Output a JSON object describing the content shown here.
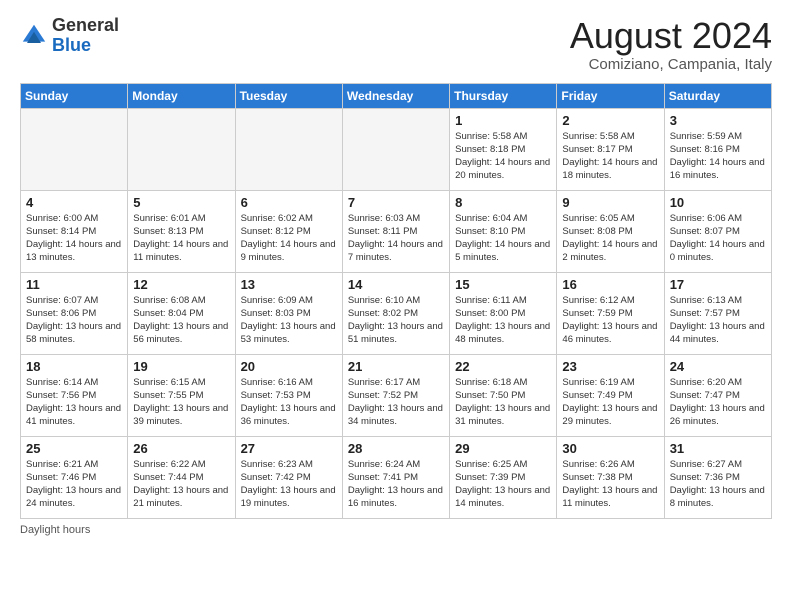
{
  "logo": {
    "general": "General",
    "blue": "Blue"
  },
  "title": {
    "month_year": "August 2024",
    "location": "Comiziano, Campania, Italy"
  },
  "days_of_week": [
    "Sunday",
    "Monday",
    "Tuesday",
    "Wednesday",
    "Thursday",
    "Friday",
    "Saturday"
  ],
  "weeks": [
    [
      {
        "day": "",
        "info": ""
      },
      {
        "day": "",
        "info": ""
      },
      {
        "day": "",
        "info": ""
      },
      {
        "day": "",
        "info": ""
      },
      {
        "day": "1",
        "info": "Sunrise: 5:58 AM\nSunset: 8:18 PM\nDaylight: 14 hours and 20 minutes."
      },
      {
        "day": "2",
        "info": "Sunrise: 5:58 AM\nSunset: 8:17 PM\nDaylight: 14 hours and 18 minutes."
      },
      {
        "day": "3",
        "info": "Sunrise: 5:59 AM\nSunset: 8:16 PM\nDaylight: 14 hours and 16 minutes."
      }
    ],
    [
      {
        "day": "4",
        "info": "Sunrise: 6:00 AM\nSunset: 8:14 PM\nDaylight: 14 hours and 13 minutes."
      },
      {
        "day": "5",
        "info": "Sunrise: 6:01 AM\nSunset: 8:13 PM\nDaylight: 14 hours and 11 minutes."
      },
      {
        "day": "6",
        "info": "Sunrise: 6:02 AM\nSunset: 8:12 PM\nDaylight: 14 hours and 9 minutes."
      },
      {
        "day": "7",
        "info": "Sunrise: 6:03 AM\nSunset: 8:11 PM\nDaylight: 14 hours and 7 minutes."
      },
      {
        "day": "8",
        "info": "Sunrise: 6:04 AM\nSunset: 8:10 PM\nDaylight: 14 hours and 5 minutes."
      },
      {
        "day": "9",
        "info": "Sunrise: 6:05 AM\nSunset: 8:08 PM\nDaylight: 14 hours and 2 minutes."
      },
      {
        "day": "10",
        "info": "Sunrise: 6:06 AM\nSunset: 8:07 PM\nDaylight: 14 hours and 0 minutes."
      }
    ],
    [
      {
        "day": "11",
        "info": "Sunrise: 6:07 AM\nSunset: 8:06 PM\nDaylight: 13 hours and 58 minutes."
      },
      {
        "day": "12",
        "info": "Sunrise: 6:08 AM\nSunset: 8:04 PM\nDaylight: 13 hours and 56 minutes."
      },
      {
        "day": "13",
        "info": "Sunrise: 6:09 AM\nSunset: 8:03 PM\nDaylight: 13 hours and 53 minutes."
      },
      {
        "day": "14",
        "info": "Sunrise: 6:10 AM\nSunset: 8:02 PM\nDaylight: 13 hours and 51 minutes."
      },
      {
        "day": "15",
        "info": "Sunrise: 6:11 AM\nSunset: 8:00 PM\nDaylight: 13 hours and 48 minutes."
      },
      {
        "day": "16",
        "info": "Sunrise: 6:12 AM\nSunset: 7:59 PM\nDaylight: 13 hours and 46 minutes."
      },
      {
        "day": "17",
        "info": "Sunrise: 6:13 AM\nSunset: 7:57 PM\nDaylight: 13 hours and 44 minutes."
      }
    ],
    [
      {
        "day": "18",
        "info": "Sunrise: 6:14 AM\nSunset: 7:56 PM\nDaylight: 13 hours and 41 minutes."
      },
      {
        "day": "19",
        "info": "Sunrise: 6:15 AM\nSunset: 7:55 PM\nDaylight: 13 hours and 39 minutes."
      },
      {
        "day": "20",
        "info": "Sunrise: 6:16 AM\nSunset: 7:53 PM\nDaylight: 13 hours and 36 minutes."
      },
      {
        "day": "21",
        "info": "Sunrise: 6:17 AM\nSunset: 7:52 PM\nDaylight: 13 hours and 34 minutes."
      },
      {
        "day": "22",
        "info": "Sunrise: 6:18 AM\nSunset: 7:50 PM\nDaylight: 13 hours and 31 minutes."
      },
      {
        "day": "23",
        "info": "Sunrise: 6:19 AM\nSunset: 7:49 PM\nDaylight: 13 hours and 29 minutes."
      },
      {
        "day": "24",
        "info": "Sunrise: 6:20 AM\nSunset: 7:47 PM\nDaylight: 13 hours and 26 minutes."
      }
    ],
    [
      {
        "day": "25",
        "info": "Sunrise: 6:21 AM\nSunset: 7:46 PM\nDaylight: 13 hours and 24 minutes."
      },
      {
        "day": "26",
        "info": "Sunrise: 6:22 AM\nSunset: 7:44 PM\nDaylight: 13 hours and 21 minutes."
      },
      {
        "day": "27",
        "info": "Sunrise: 6:23 AM\nSunset: 7:42 PM\nDaylight: 13 hours and 19 minutes."
      },
      {
        "day": "28",
        "info": "Sunrise: 6:24 AM\nSunset: 7:41 PM\nDaylight: 13 hours and 16 minutes."
      },
      {
        "day": "29",
        "info": "Sunrise: 6:25 AM\nSunset: 7:39 PM\nDaylight: 13 hours and 14 minutes."
      },
      {
        "day": "30",
        "info": "Sunrise: 6:26 AM\nSunset: 7:38 PM\nDaylight: 13 hours and 11 minutes."
      },
      {
        "day": "31",
        "info": "Sunrise: 6:27 AM\nSunset: 7:36 PM\nDaylight: 13 hours and 8 minutes."
      }
    ]
  ],
  "footer": {
    "daylight_label": "Daylight hours"
  }
}
